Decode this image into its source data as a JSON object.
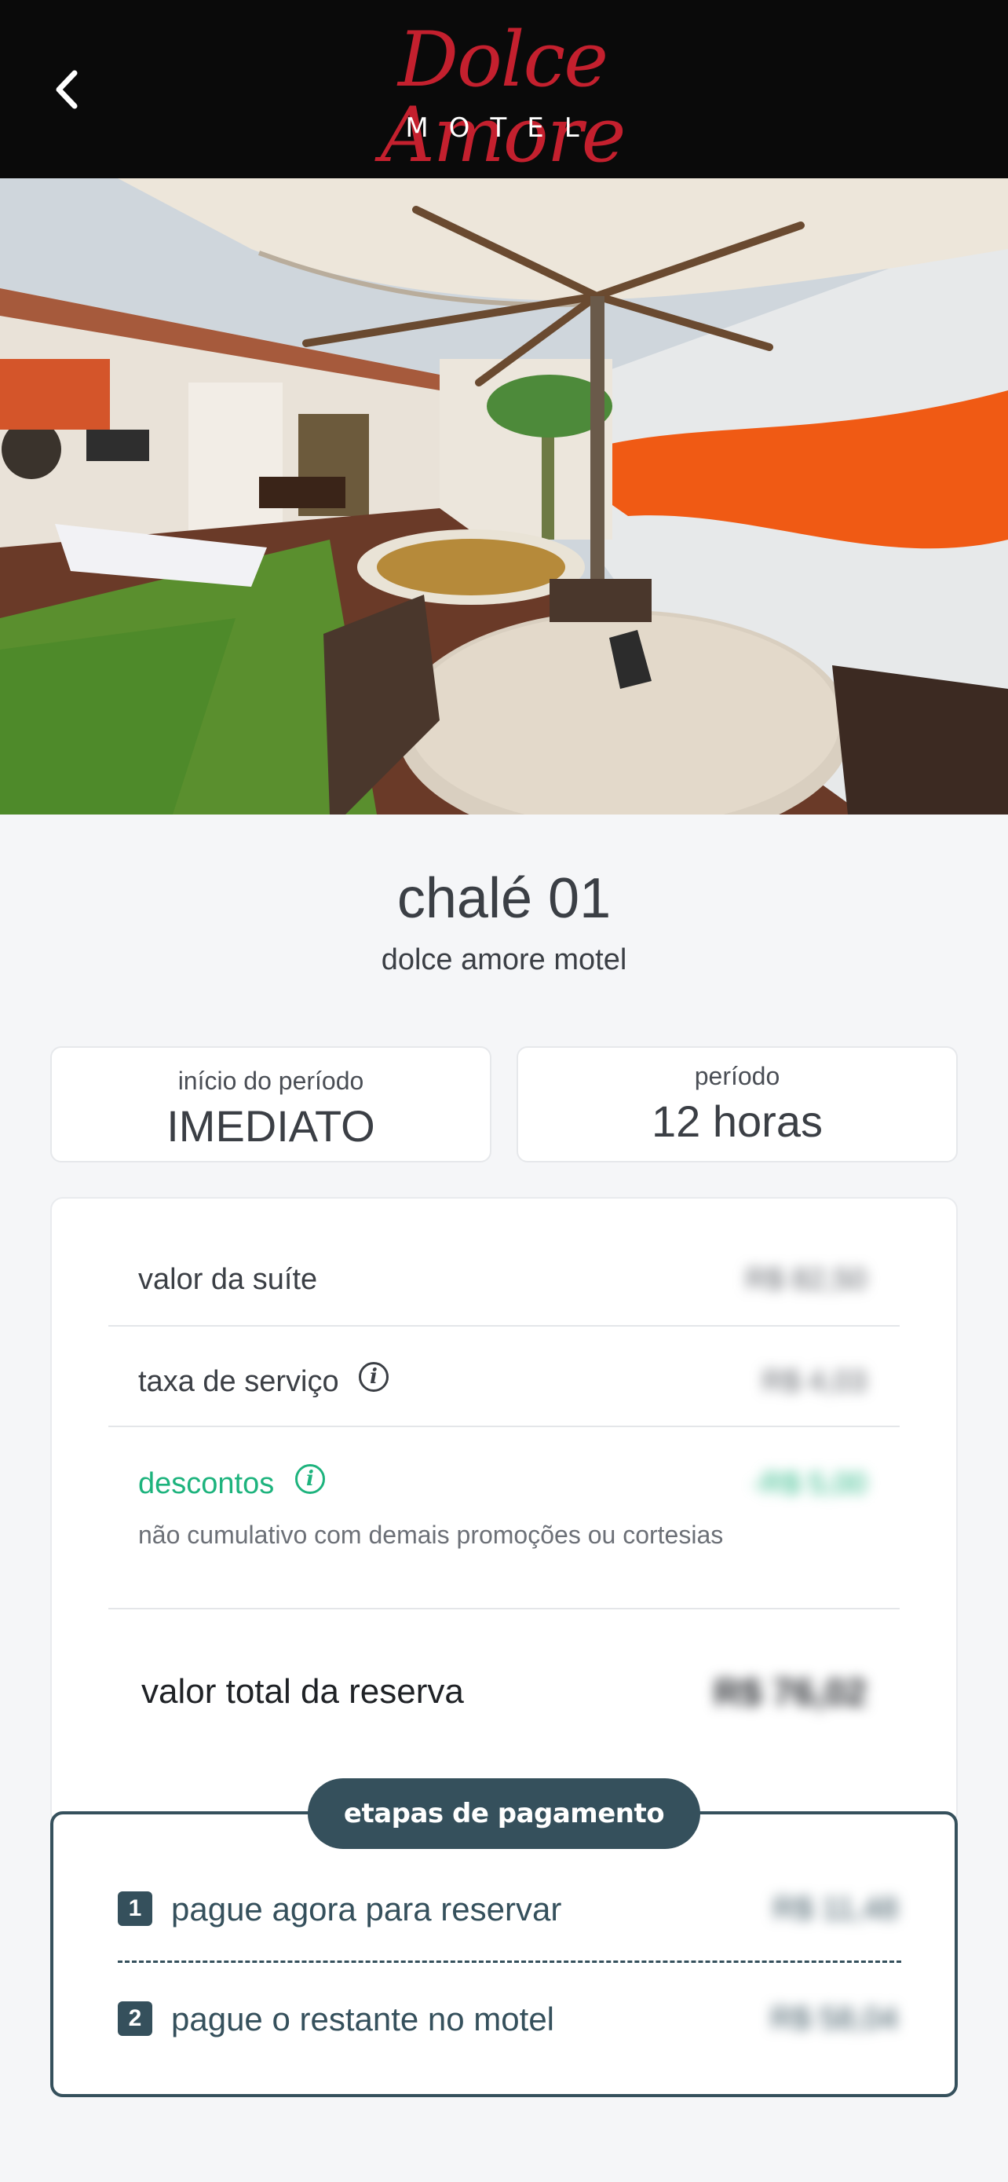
{
  "header": {
    "brand_script": "Dolce Amore",
    "brand_sub": "MOTEL",
    "back_icon": "chevron-left-icon"
  },
  "gallery": {
    "total_slides": 12,
    "active_index": 0
  },
  "room": {
    "name": "chalé 01",
    "motel": "dolce amore motel"
  },
  "period": {
    "start_label": "início do período",
    "start_value": "IMEDIATO",
    "duration_label": "período",
    "duration_value": "12 horas"
  },
  "pricing": {
    "suite_label": "valor da suíte",
    "suite_value": "R$ 82,50",
    "service_label": "taxa de serviço",
    "service_value": "R$ 4,03",
    "discount_label": "descontos",
    "discount_value": "-R$ 5,00",
    "discount_note": "não cumulativo com demais promoções ou cortesias",
    "total_label": "valor total da reserva",
    "total_value": "R$ 76,02"
  },
  "payment": {
    "title": "etapas de pagamento",
    "step1_num": "1",
    "step1_label": "pague agora para reservar",
    "step1_value": "R$ 11,48",
    "step2_num": "2",
    "step2_label": "pague o restante no motel",
    "step2_value": "R$ 58,04"
  },
  "colors": {
    "header_bg": "#0a0a0a",
    "brand_red": "#c4202e",
    "accent_dark": "#35505c",
    "discount_green": "#1db37d"
  }
}
